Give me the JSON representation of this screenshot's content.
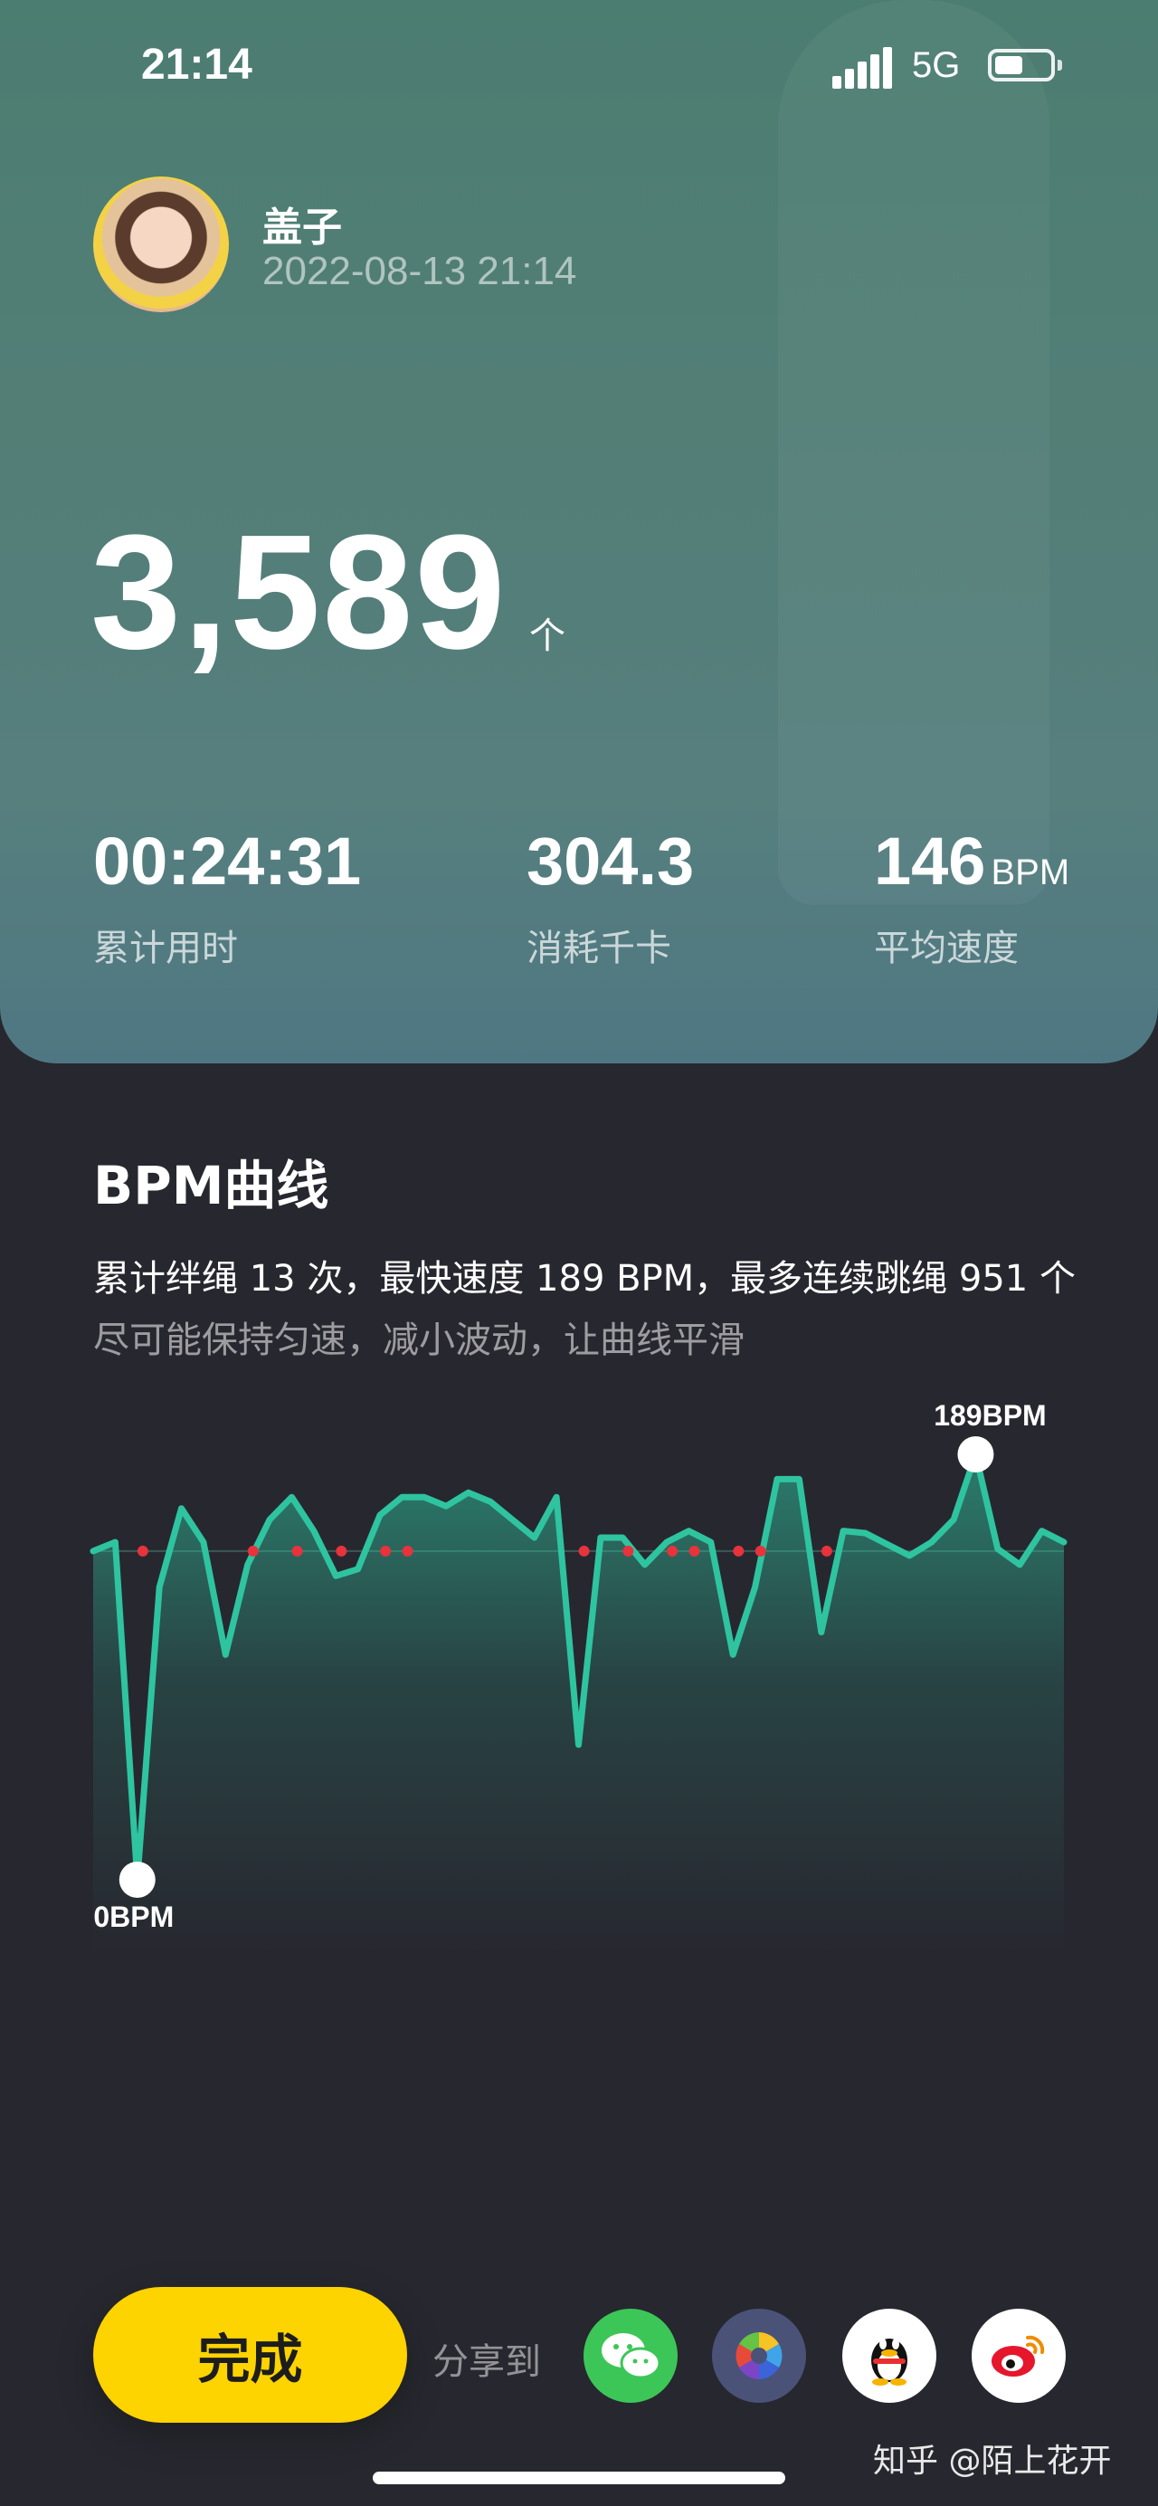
{
  "status_bar": {
    "time": "21:14",
    "network": "5G"
  },
  "user": {
    "name": "盖子",
    "datetime": "2022-08-13 21:14"
  },
  "workout": {
    "count": "3,589",
    "count_unit": "个"
  },
  "stats": [
    {
      "value": "00:24:31",
      "unit": "",
      "label": "累计用时"
    },
    {
      "value": "304.3",
      "unit": "",
      "label": "消耗千卡"
    },
    {
      "value": "146",
      "unit": "BPM",
      "label": "平均速度"
    }
  ],
  "bpm_section": {
    "title": "BPM曲线",
    "summary": "累计绊绳 13 次，最快速度 189 BPM，最多连续跳绳 951 个",
    "tip": "尽可能保持匀速，减小波动，让曲线平滑"
  },
  "chart_data": {
    "type": "area",
    "title": "BPM曲线",
    "max_label": "189BPM",
    "min_label": "0BPM",
    "ylim": [
      0,
      189
    ],
    "average": 146,
    "series": [
      {
        "values": [
          146,
          150,
          0,
          130,
          165,
          150,
          100,
          140,
          160,
          170,
          155,
          135,
          138,
          162,
          170,
          170,
          166,
          172,
          168,
          160,
          152,
          170,
          60,
          152,
          152,
          140,
          150,
          155,
          150,
          100,
          130,
          178,
          178,
          110,
          155,
          154,
          149,
          144,
          150,
          160,
          189,
          147,
          140,
          155,
          150
        ]
      }
    ],
    "trip_indices": [
      2,
      7,
      9,
      11,
      13,
      14,
      22,
      24,
      26,
      27,
      29,
      30,
      33
    ],
    "colors": {
      "line": "#2ec4a0",
      "trip_marker": "#e8323c",
      "avg_line": "#3a5a55"
    }
  },
  "actions": {
    "done_label": "完成",
    "share_label": "分享到",
    "share_targets": [
      {
        "name": "wechat-icon",
        "color": "#3dc658"
      },
      {
        "name": "moments-icon",
        "color": "#4a5278"
      },
      {
        "name": "qq-icon",
        "color": "#ffffff"
      },
      {
        "name": "weibo-icon",
        "color": "#ffffff"
      }
    ]
  },
  "watermark": "知乎 @陌上花开"
}
